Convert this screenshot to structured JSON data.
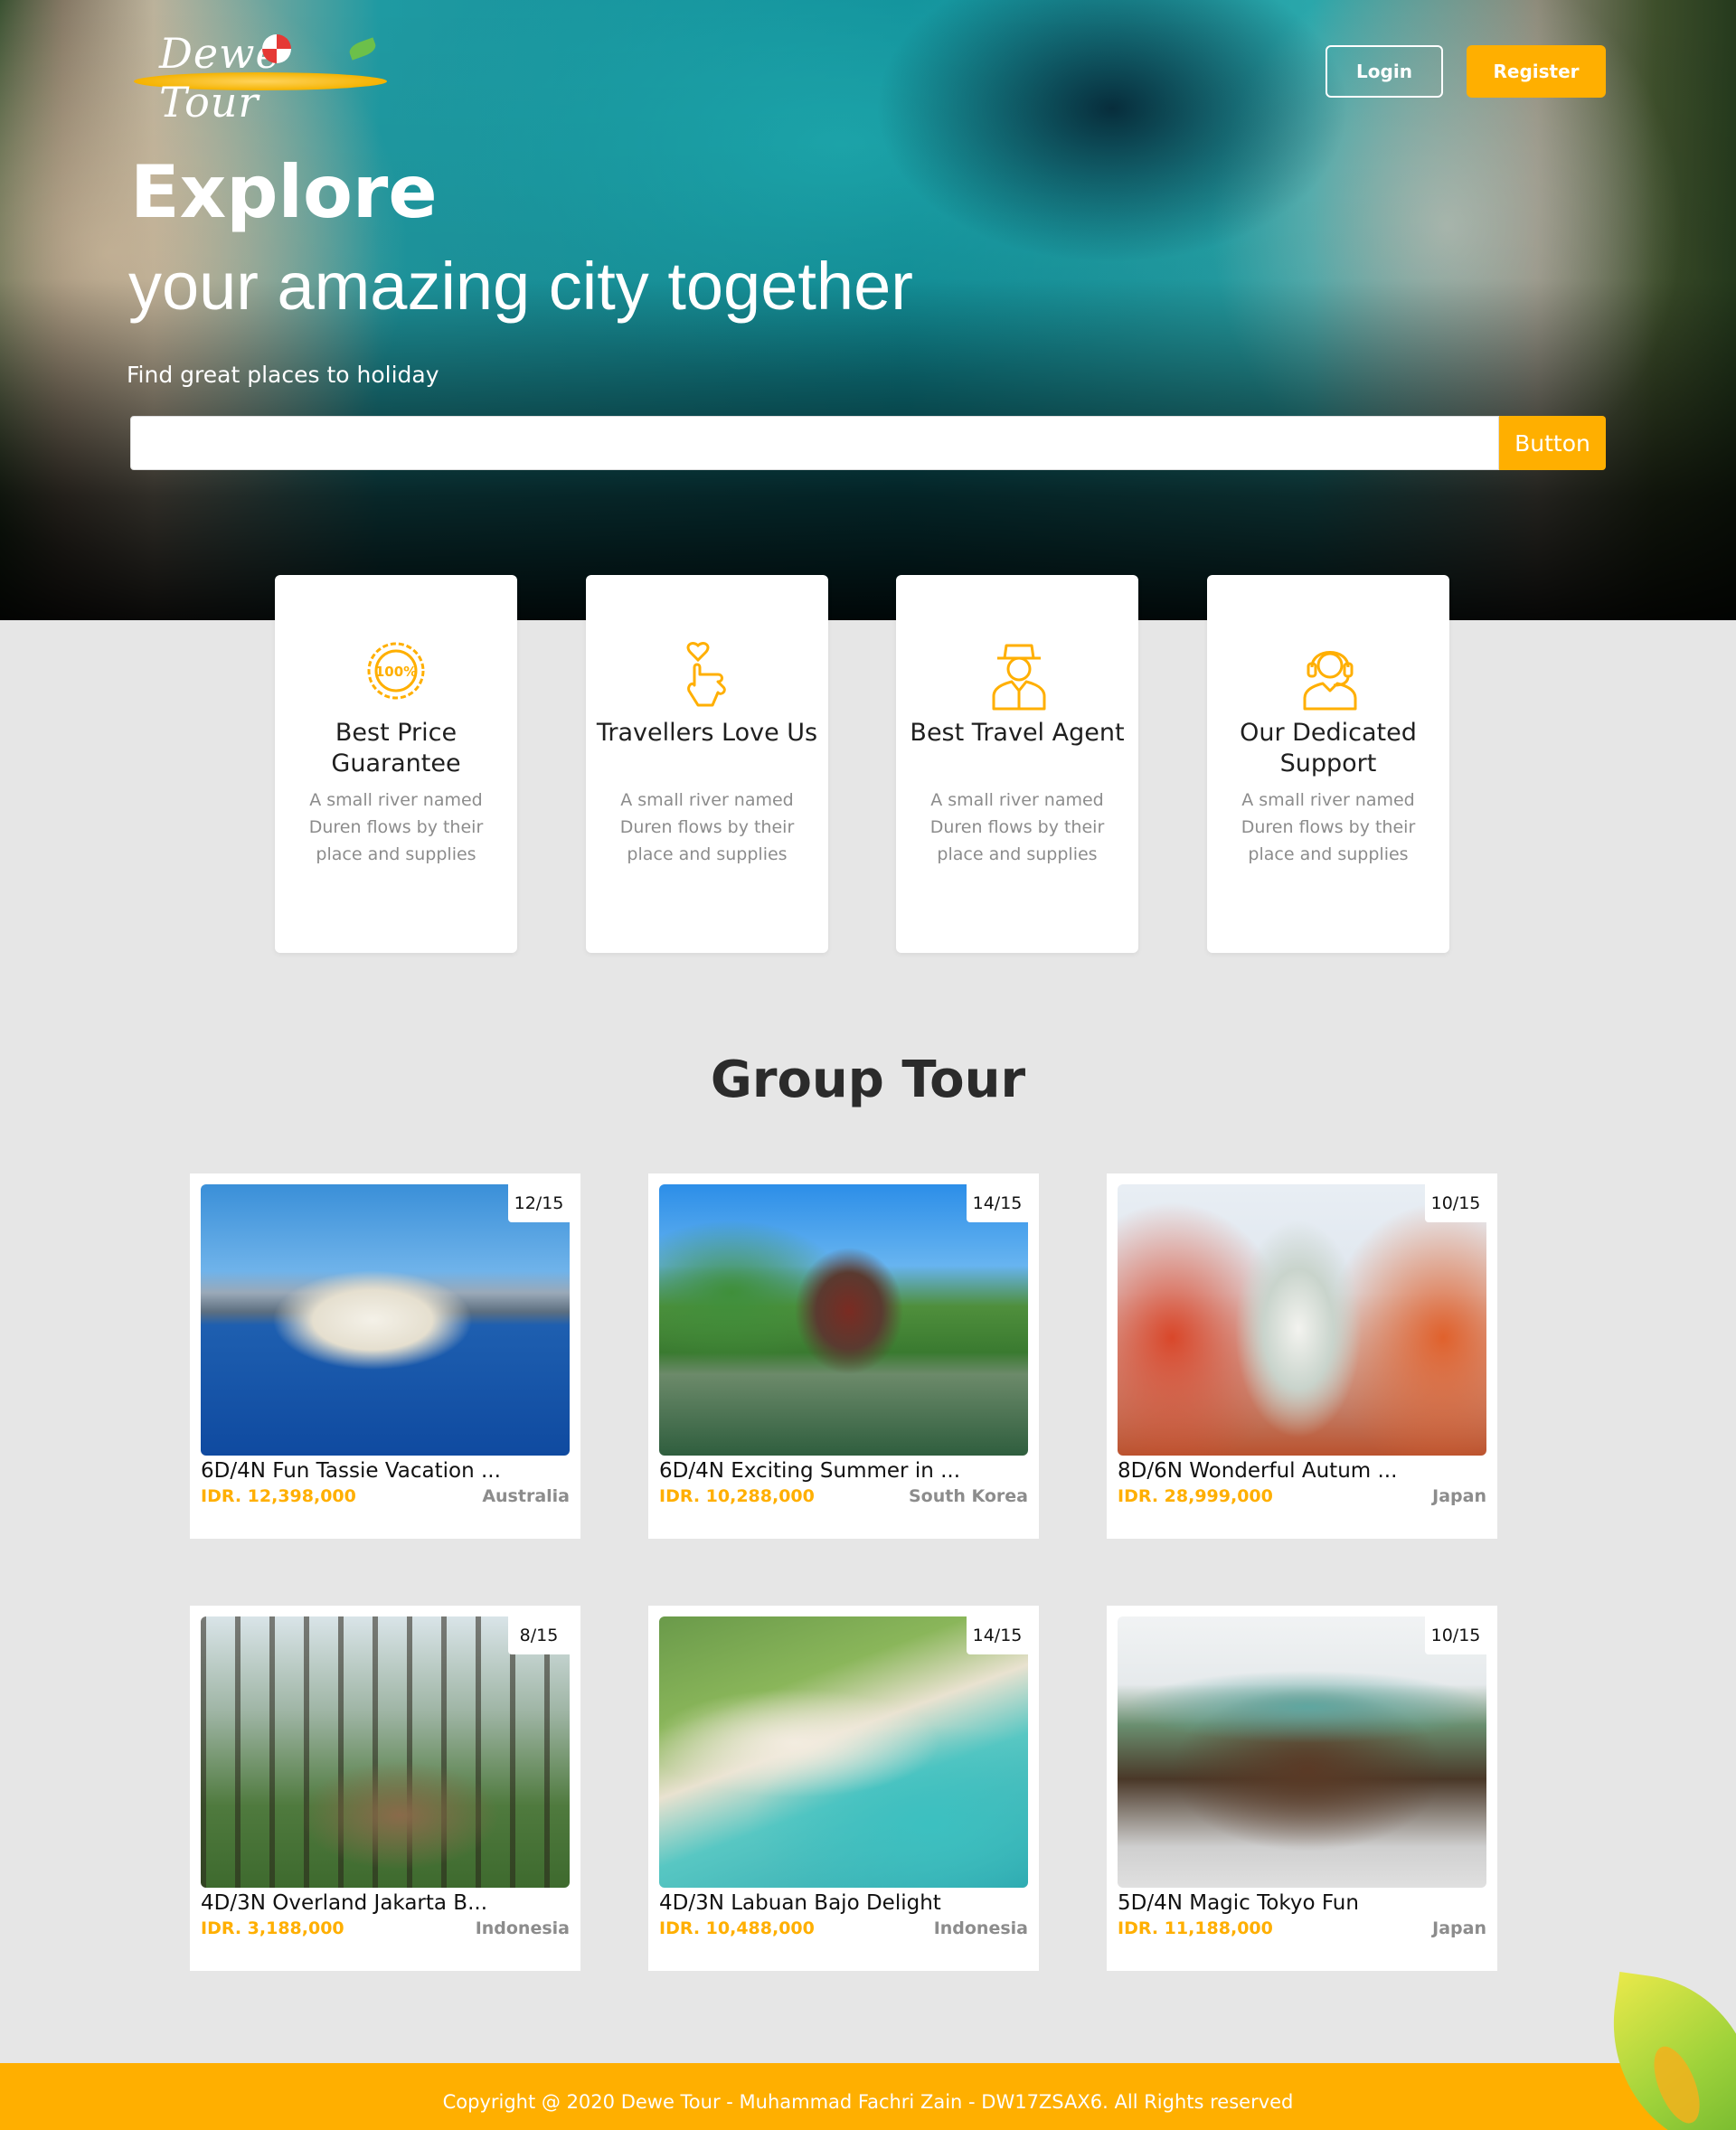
{
  "header": {
    "logo_text": "Dewe Tour",
    "login_label": "Login",
    "register_label": "Register"
  },
  "hero": {
    "title": "Explore",
    "subtitle": "your amazing city together",
    "tagline": "Find great places to holiday",
    "search_placeholder": "",
    "search_button": "Button"
  },
  "features": [
    {
      "icon": "badge-100-icon",
      "title": "Best Price Guarantee",
      "description": "A small river named Duren flows by their place and supplies"
    },
    {
      "icon": "heart-hand-icon",
      "title": "Travellers Love Us",
      "description": "A small river named Duren flows by their place and supplies"
    },
    {
      "icon": "agent-icon",
      "title": "Best Travel Agent",
      "description": "A small river named Duren flows by their place and supplies"
    },
    {
      "icon": "headset-support-icon",
      "title": "Our Dedicated Support",
      "description": "A small river named Duren flows by their place and supplies"
    }
  ],
  "group_tour": {
    "title": "Group Tour",
    "tours": [
      {
        "name": "6D/4N Fun Tassie Vacation ...",
        "price": "IDR. 12,398,000",
        "country": "Australia",
        "quota": "12/15"
      },
      {
        "name": "6D/4N Exciting Summer in ...",
        "price": "IDR. 10,288,000",
        "country": "South Korea",
        "quota": "14/15"
      },
      {
        "name": "8D/6N Wonderful Autum ...",
        "price": "IDR. 28,999,000",
        "country": "Japan",
        "quota": "10/15"
      },
      {
        "name": "4D/3N Overland Jakarta B...",
        "price": "IDR. 3,188,000",
        "country": "Indonesia",
        "quota": "8/15"
      },
      {
        "name": "4D/3N Labuan Bajo Delight",
        "price": "IDR. 10,488,000",
        "country": "Indonesia",
        "quota": "14/15"
      },
      {
        "name": "5D/4N Magic Tokyo Fun",
        "price": "IDR. 11,188,000",
        "country": "Japan",
        "quota": "10/15"
      }
    ]
  },
  "footer": {
    "copyright": "Copyright @ 2020 Dewe Tour - Muhammad Fachri Zain - DW17ZSAX6. All Rights reserved"
  },
  "colors": {
    "accent": "#ffaf00",
    "muted": "#8c8c8c",
    "background": "#e6e6e6"
  }
}
